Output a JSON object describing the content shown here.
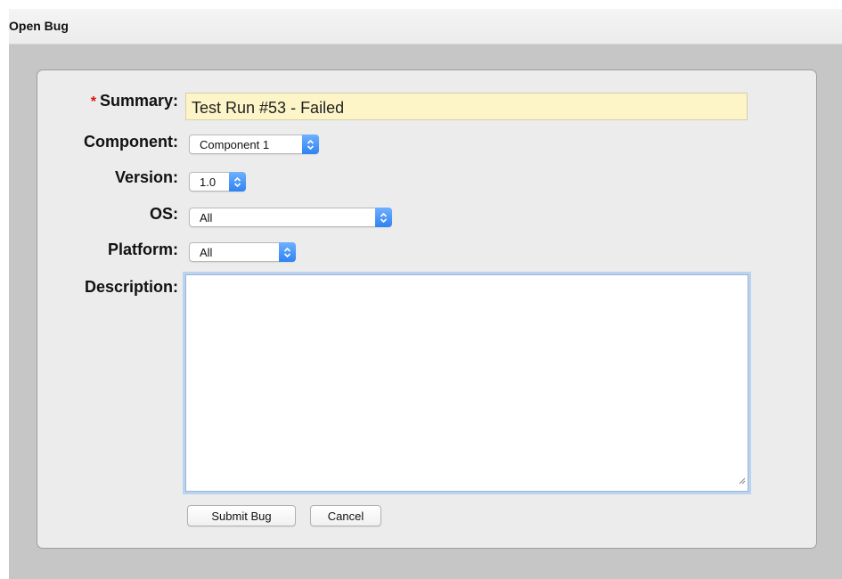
{
  "window": {
    "title": "Open Bug"
  },
  "form": {
    "required_marker": "*",
    "summary": {
      "label": "Summary:",
      "value": "Test Run #53 - Failed"
    },
    "component": {
      "label": "Component:",
      "selected": "Component 1"
    },
    "version": {
      "label": "Version:",
      "selected": "1.0"
    },
    "os": {
      "label": "OS:",
      "selected": "All"
    },
    "platform": {
      "label": "Platform:",
      "selected": "All"
    },
    "description": {
      "label": "Description:",
      "value": ""
    }
  },
  "buttons": {
    "submit": "Submit Bug",
    "cancel": "Cancel"
  },
  "colors": {
    "summary_background": "#fdf5c8",
    "select_arrow_accent": "#2f83f2",
    "required_marker": "#dd1111",
    "focus_ring": "#bcd3ef"
  },
  "icons": {
    "select_arrow": "chevron-up-down-icon",
    "resize_grip": "resize-grip-icon"
  }
}
